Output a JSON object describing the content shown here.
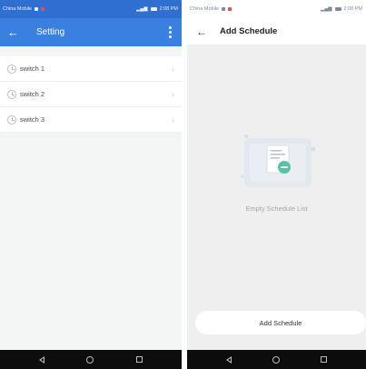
{
  "left_screen": {
    "status": {
      "carrier": "China Mobile",
      "time": "2:08 PM"
    },
    "appbar": {
      "title": "Setting",
      "back": "←"
    },
    "items": [
      {
        "label": "switch 1"
      },
      {
        "label": "switch 2"
      },
      {
        "label": "switch 3"
      }
    ],
    "chevron": "›"
  },
  "right_screen": {
    "status": {
      "carrier": "China Mobile",
      "time": "2:08 PM"
    },
    "appbar": {
      "title": "Add Schedule",
      "back": "←"
    },
    "empty_text": "Empty Schedule List",
    "button_label": "Add Schedule"
  },
  "colors": {
    "status_blue": "#2f6fd0",
    "appbar_blue": "#3a80e0",
    "accent_teal": "#5cc0a8"
  },
  "icons": {
    "nav": [
      "back-triangle-icon",
      "home-circle-icon",
      "recent-square-icon"
    ]
  }
}
